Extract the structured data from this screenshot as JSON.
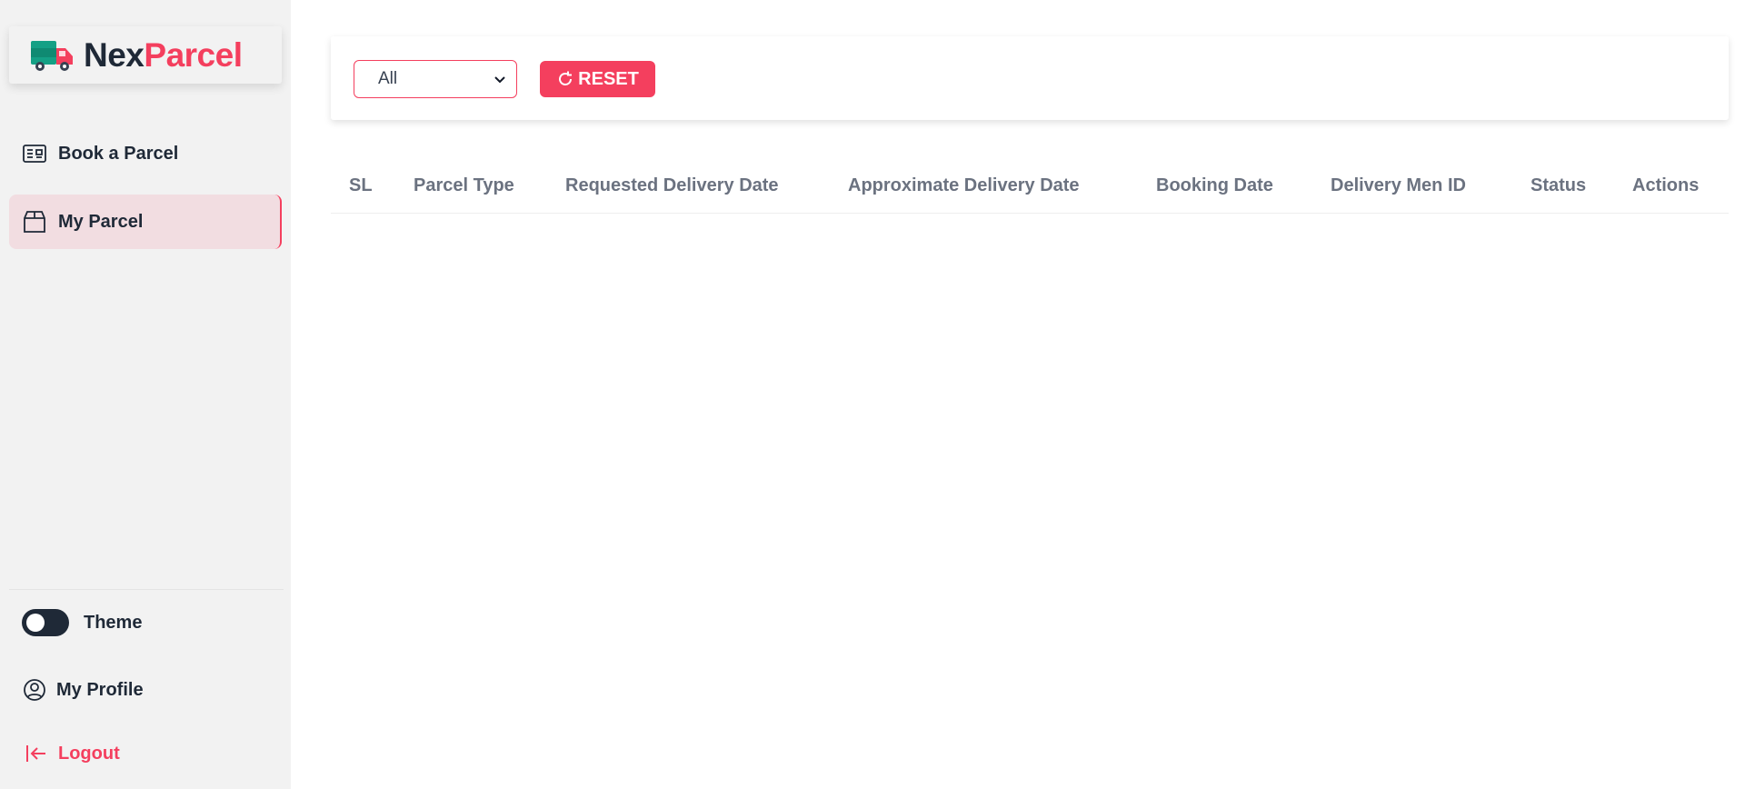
{
  "brand": {
    "name_part1": "Nex",
    "name_part2": "Parcel",
    "logo_icon": "truck-icon",
    "accent_color": "#f43f5e",
    "truck_colors": [
      "#14a085",
      "#f43f5e"
    ]
  },
  "sidebar": {
    "items": [
      {
        "label": "Book a Parcel",
        "icon": "newspaper-icon",
        "active": false
      },
      {
        "label": "My Parcel",
        "icon": "box-icon",
        "active": true
      }
    ],
    "theme_label": "Theme",
    "profile_label": "My Profile",
    "logout_label": "Logout"
  },
  "filter": {
    "select_value": "All",
    "reset_label": "RESET"
  },
  "table": {
    "columns": [
      "SL",
      "Parcel Type",
      "Requested Delivery Date",
      "Approximate Delivery Date",
      "Booking Date",
      "Delivery Men ID",
      "Status",
      "Actions"
    ],
    "rows": []
  }
}
